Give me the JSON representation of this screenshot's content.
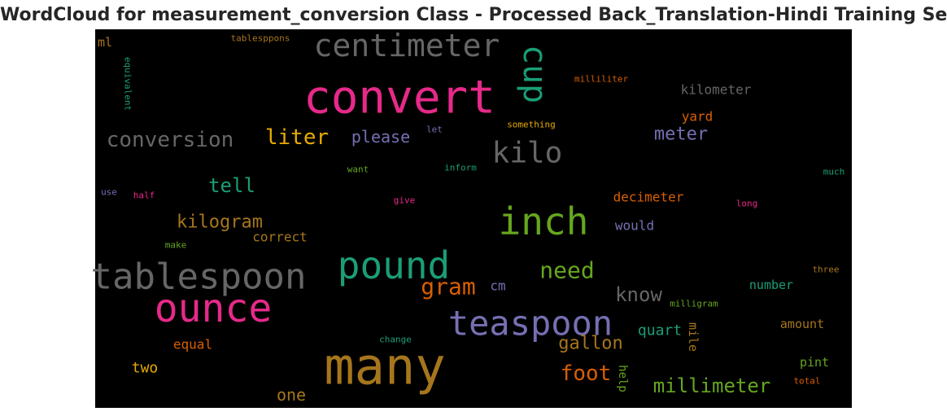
{
  "chart_data": {
    "type": "wordcloud",
    "title": "WordCloud for measurement_conversion Class - Processed Back_Translation-Hindi Training Set",
    "background": "#000000",
    "palette": [
      "#1b9e77",
      "#d95f02",
      "#7570b3",
      "#e7298a",
      "#66a61e",
      "#e6ab02",
      "#a6761d",
      "#666666"
    ],
    "words": [
      {
        "text": "many",
        "weight": 62,
        "color": "#a6761d"
      },
      {
        "text": "convert",
        "weight": 56,
        "color": "#e7298a"
      },
      {
        "text": "ounce",
        "weight": 48,
        "color": "#e7298a"
      },
      {
        "text": "inch",
        "weight": 46,
        "color": "#66a61e"
      },
      {
        "text": "pound",
        "weight": 46,
        "color": "#1b9e77"
      },
      {
        "text": "tablespoon",
        "weight": 44,
        "color": "#666666"
      },
      {
        "text": "teaspoon",
        "weight": 42,
        "color": "#7570b3"
      },
      {
        "text": "centimeter",
        "weight": 38,
        "color": "#666666"
      },
      {
        "text": "cup",
        "weight": 40,
        "color": "#1b9e77",
        "orientation": "vertical"
      },
      {
        "text": "kilo",
        "weight": 36,
        "color": "#666666"
      },
      {
        "text": "gram",
        "weight": 28,
        "color": "#d95f02"
      },
      {
        "text": "need",
        "weight": 28,
        "color": "#66a61e"
      },
      {
        "text": "foot",
        "weight": 26,
        "color": "#d95f02"
      },
      {
        "text": "conversion",
        "weight": 26,
        "color": "#666666"
      },
      {
        "text": "liter",
        "weight": 26,
        "color": "#e6ab02"
      },
      {
        "text": "tell",
        "weight": 24,
        "color": "#1b9e77"
      },
      {
        "text": "millimeter",
        "weight": 24,
        "color": "#66a61e"
      },
      {
        "text": "know",
        "weight": 24,
        "color": "#666666"
      },
      {
        "text": "kilogram",
        "weight": 22,
        "color": "#a6761d"
      },
      {
        "text": "meter",
        "weight": 22,
        "color": "#7570b3"
      },
      {
        "text": "gallon",
        "weight": 22,
        "color": "#a6761d"
      },
      {
        "text": "please",
        "weight": 20,
        "color": "#7570b3"
      },
      {
        "text": "one",
        "weight": 20,
        "color": "#a6761d"
      },
      {
        "text": "two",
        "weight": 18,
        "color": "#e6ab02"
      },
      {
        "text": "quart",
        "weight": 18,
        "color": "#1b9e77"
      },
      {
        "text": "kilometer",
        "weight": 16,
        "color": "#666666"
      },
      {
        "text": "yard",
        "weight": 16,
        "color": "#d95f02"
      },
      {
        "text": "decimeter",
        "weight": 16,
        "color": "#d95f02"
      },
      {
        "text": "correct",
        "weight": 16,
        "color": "#a6761d"
      },
      {
        "text": "would",
        "weight": 16,
        "color": "#7570b3"
      },
      {
        "text": "equal",
        "weight": 16,
        "color": "#d95f02"
      },
      {
        "text": "cm",
        "weight": 16,
        "color": "#7570b3"
      },
      {
        "text": "number",
        "weight": 15,
        "color": "#1b9e77"
      },
      {
        "text": "amount",
        "weight": 15,
        "color": "#a6761d"
      },
      {
        "text": "pint",
        "weight": 15,
        "color": "#66a61e"
      },
      {
        "text": "ml",
        "weight": 15,
        "color": "#a6761d"
      },
      {
        "text": "mile",
        "weight": 15,
        "color": "#a6761d",
        "orientation": "vertical"
      },
      {
        "text": "help",
        "weight": 14,
        "color": "#66a61e",
        "orientation": "vertical"
      },
      {
        "text": "milliliter",
        "weight": 11,
        "color": "#d95f02"
      },
      {
        "text": "something",
        "weight": 11,
        "color": "#e6ab02"
      },
      {
        "text": "tablesppons",
        "weight": 11,
        "color": "#a6761d"
      },
      {
        "text": "equivalent",
        "weight": 11,
        "color": "#1b9e77",
        "orientation": "vertical"
      },
      {
        "text": "let",
        "weight": 11,
        "color": "#7570b3"
      },
      {
        "text": "want",
        "weight": 11,
        "color": "#66a61e"
      },
      {
        "text": "inform",
        "weight": 11,
        "color": "#1b9e77"
      },
      {
        "text": "use",
        "weight": 11,
        "color": "#7570b3"
      },
      {
        "text": "half",
        "weight": 11,
        "color": "#e7298a"
      },
      {
        "text": "give",
        "weight": 11,
        "color": "#e7298a"
      },
      {
        "text": "long",
        "weight": 11,
        "color": "#e7298a"
      },
      {
        "text": "much",
        "weight": 11,
        "color": "#1b9e77"
      },
      {
        "text": "make",
        "weight": 11,
        "color": "#66a61e"
      },
      {
        "text": "milligram",
        "weight": 11,
        "color": "#66a61e"
      },
      {
        "text": "change",
        "weight": 11,
        "color": "#1b9e77"
      },
      {
        "text": "three",
        "weight": 11,
        "color": "#a6761d"
      },
      {
        "text": "total",
        "weight": 11,
        "color": "#d95f02"
      }
    ]
  }
}
